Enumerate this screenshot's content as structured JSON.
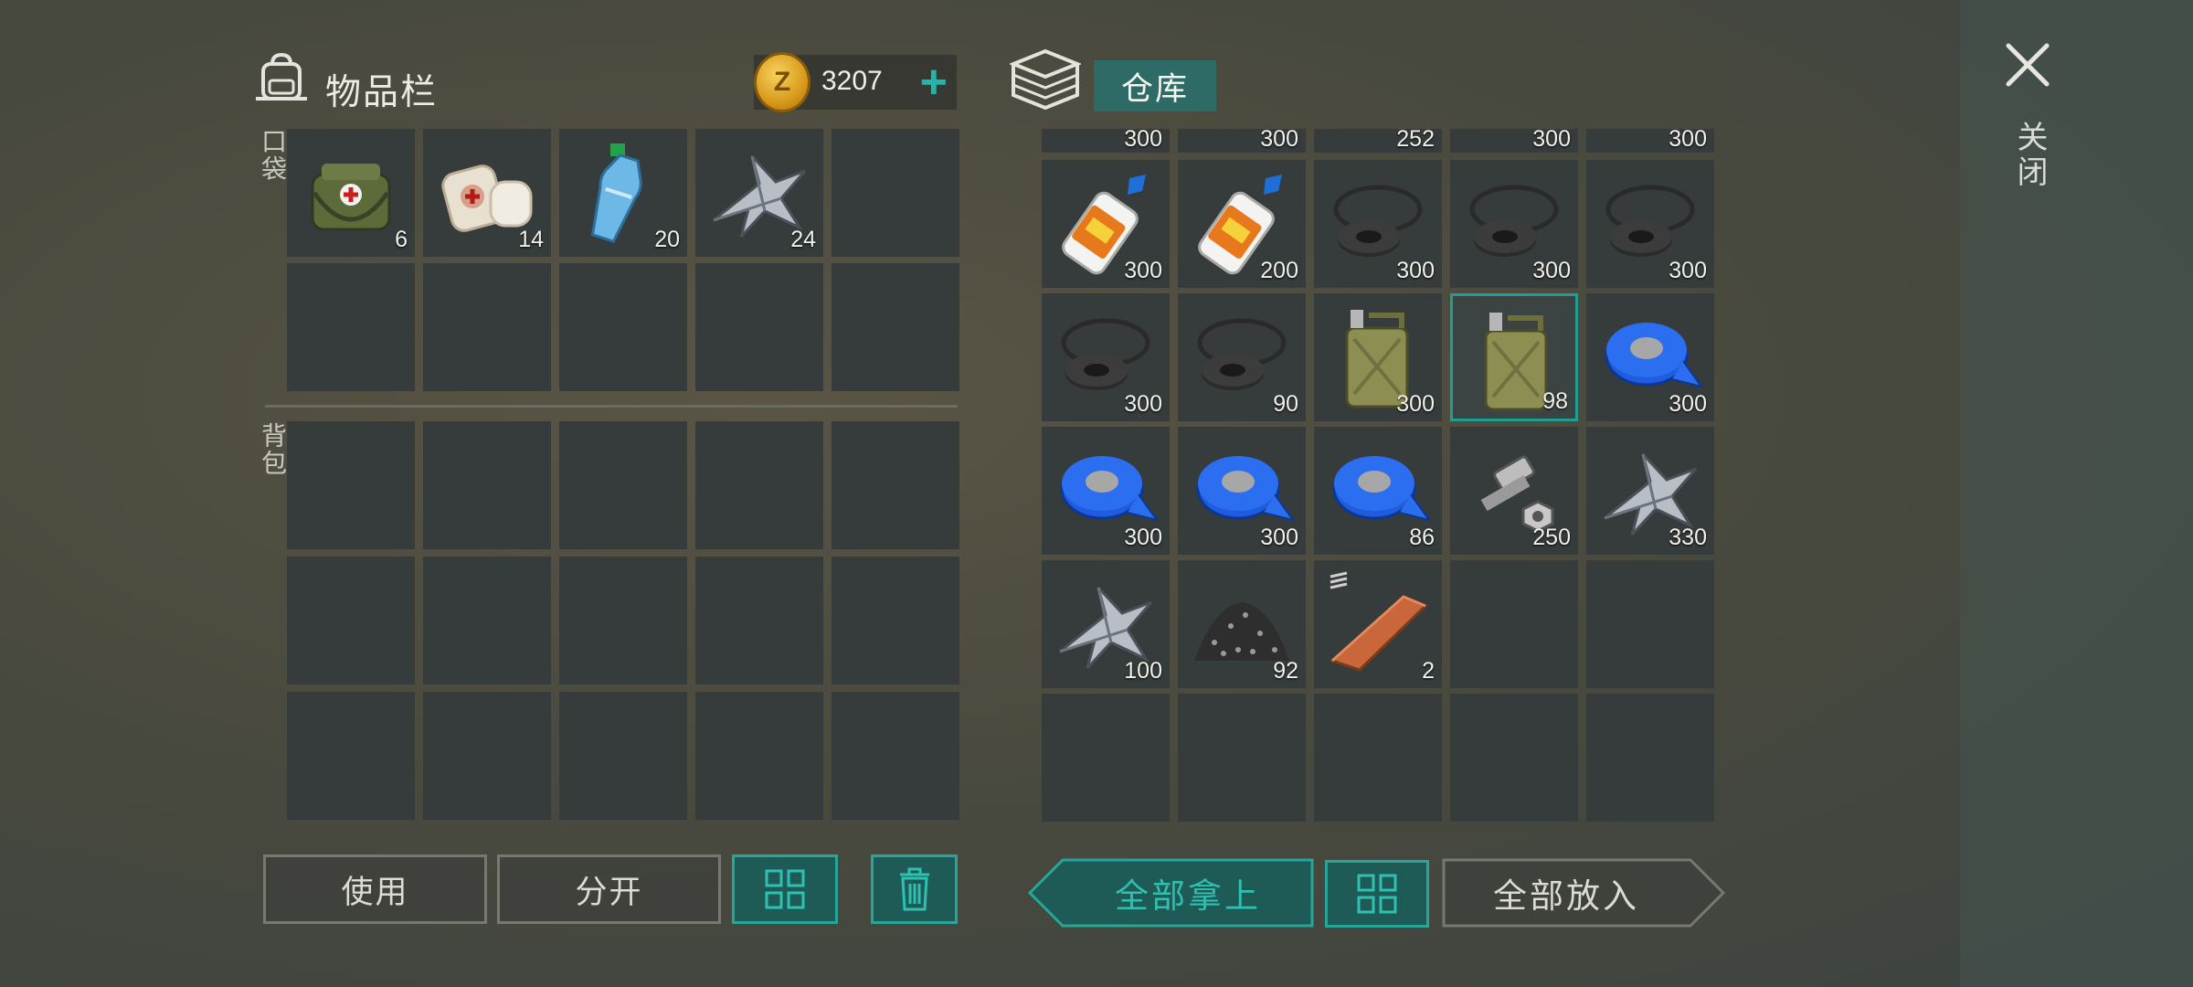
{
  "inventory": {
    "title": "物品栏",
    "pocket_label": "口袋",
    "backpack_label": "背包",
    "coins": "3207",
    "add_coins": "+",
    "pocket_slots": [
      {
        "item": "medkit-bag",
        "count": "6"
      },
      {
        "item": "bandage",
        "count": "14"
      },
      {
        "item": "water-bottle",
        "count": "20"
      },
      {
        "item": "scrap-metal",
        "count": "24"
      },
      {
        "item": "",
        "count": ""
      },
      {
        "item": "",
        "count": ""
      },
      {
        "item": "",
        "count": ""
      },
      {
        "item": "",
        "count": ""
      },
      {
        "item": "",
        "count": ""
      },
      {
        "item": "",
        "count": ""
      }
    ],
    "actions": {
      "use": "使用",
      "split": "分开"
    }
  },
  "storage": {
    "title": "仓库",
    "partial_row_counts": [
      "300",
      "300",
      "252",
      "300",
      "300"
    ],
    "slots": [
      {
        "item": "super-glue",
        "count": "300"
      },
      {
        "item": "super-glue",
        "count": "200"
      },
      {
        "item": "rubber-parts",
        "count": "300"
      },
      {
        "item": "rubber-parts",
        "count": "300"
      },
      {
        "item": "rubber-parts",
        "count": "300"
      },
      {
        "item": "rubber-parts",
        "count": "300"
      },
      {
        "item": "rubber-parts",
        "count": "90"
      },
      {
        "item": "jerry-can",
        "count": "300"
      },
      {
        "item": "jerry-can",
        "count": "98",
        "selected": true
      },
      {
        "item": "tape",
        "count": "300"
      },
      {
        "item": "tape",
        "count": "300"
      },
      {
        "item": "tape",
        "count": "300"
      },
      {
        "item": "tape",
        "count": "86"
      },
      {
        "item": "bolts-nuts",
        "count": "250"
      },
      {
        "item": "scrap-metal",
        "count": "330"
      },
      {
        "item": "scrap-metal",
        "count": "100"
      },
      {
        "item": "gravel-pile",
        "count": "92"
      },
      {
        "item": "copper-bar",
        "count": "2"
      },
      {
        "item": "",
        "count": ""
      },
      {
        "item": "",
        "count": ""
      },
      {
        "item": "",
        "count": ""
      },
      {
        "item": "",
        "count": ""
      },
      {
        "item": "",
        "count": ""
      },
      {
        "item": "",
        "count": ""
      },
      {
        "item": "",
        "count": ""
      }
    ],
    "actions": {
      "take_all": "全部拿上",
      "put_all": "全部放入"
    }
  },
  "close": {
    "label": "关闭"
  },
  "colors": {
    "accent": "#25a699",
    "slot": "#363b3b",
    "tab": "#2f6b66"
  }
}
